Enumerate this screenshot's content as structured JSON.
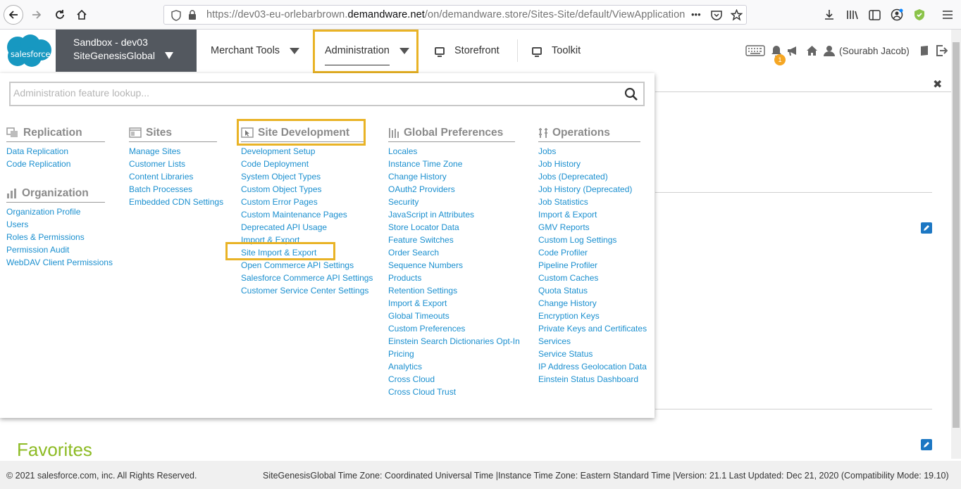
{
  "browser": {
    "url_prefix": "https://dev03-eu-orlebarbrown.",
    "url_domain": "demandware.net",
    "url_suffix": "/on/demandware.store/Sites-Site/default/ViewApplication-Selec",
    "more_label": "•••"
  },
  "header": {
    "logo_text": "salesforce",
    "sandbox_line1": "Sandbox - dev03",
    "sandbox_line2": "SiteGenesisGlobal",
    "nav": {
      "merchant_tools": "Merchant Tools",
      "administration": "Administration",
      "storefront": "Storefront",
      "toolkit": "Toolkit"
    },
    "notification_count": "1",
    "user_name": "(Sourabh Jacob)"
  },
  "menu": {
    "search_placeholder": "Administration feature lookup...",
    "replication": {
      "title": "Replication",
      "items": [
        "Data Replication",
        "Code Replication"
      ]
    },
    "organization": {
      "title": "Organization",
      "items": [
        "Organization Profile",
        "Users",
        "Roles & Permissions",
        "Permission Audit",
        "WebDAV Client Permissions"
      ]
    },
    "sites": {
      "title": "Sites",
      "items": [
        "Manage Sites",
        "Customer Lists",
        "Content Libraries",
        "Batch Processes",
        "Embedded CDN Settings"
      ]
    },
    "site_development": {
      "title": "Site Development",
      "items": [
        "Development Setup",
        "Code Deployment",
        "System Object Types",
        "Custom Object Types",
        "Custom Error Pages",
        "Custom Maintenance Pages",
        "Deprecated API Usage",
        "Import & Export",
        "Site Import & Export",
        "Open Commerce API Settings",
        "Salesforce Commerce API Settings",
        "Customer Service Center Settings"
      ]
    },
    "global_preferences": {
      "title": "Global Preferences",
      "items": [
        "Locales",
        "Instance Time Zone",
        "Change History",
        "OAuth2 Providers",
        "Security",
        "JavaScript in Attributes",
        "Store Locator Data",
        "Feature Switches",
        "Order Search",
        "Sequence Numbers",
        "Products",
        "Retention Settings",
        "Import & Export",
        "Global Timeouts",
        "Custom Preferences",
        "Einstein Search Dictionaries Opt-In",
        "Pricing",
        "Analytics",
        "Cross Cloud",
        "Cross Cloud Trust"
      ]
    },
    "operations": {
      "title": "Operations",
      "items": [
        "Jobs",
        "Job History",
        "Jobs (Deprecated)",
        "Job History (Deprecated)",
        "Job Statistics",
        "Import & Export",
        "GMV Reports",
        "Custom Log Settings",
        "Code Profiler",
        "Pipeline Profiler",
        "Custom Caches",
        "Quota Status",
        "Change History",
        "Encryption Keys",
        "Private Keys and Certificates",
        "Services",
        "Service Status",
        "IP Address Geolocation Data",
        "Einstein Status Dashboard"
      ]
    }
  },
  "page": {
    "close_label": "✖",
    "favorites_title": "Favorites"
  },
  "footer": {
    "copyright": "© 2021 salesforce.com, inc. All Rights Reserved.",
    "info": "SiteGenesisGlobal Time Zone: Coordinated Universal Time |Instance Time Zone: Eastern Standard Time |Version: 21.1 Last Updated: Dec 21, 2020 (Compatibility Mode: 19.10)"
  },
  "colors": {
    "link": "#1a8fcf",
    "highlight": "#e9b326",
    "favorites": "#8dbb24",
    "site_selector_bg": "#53585f"
  }
}
